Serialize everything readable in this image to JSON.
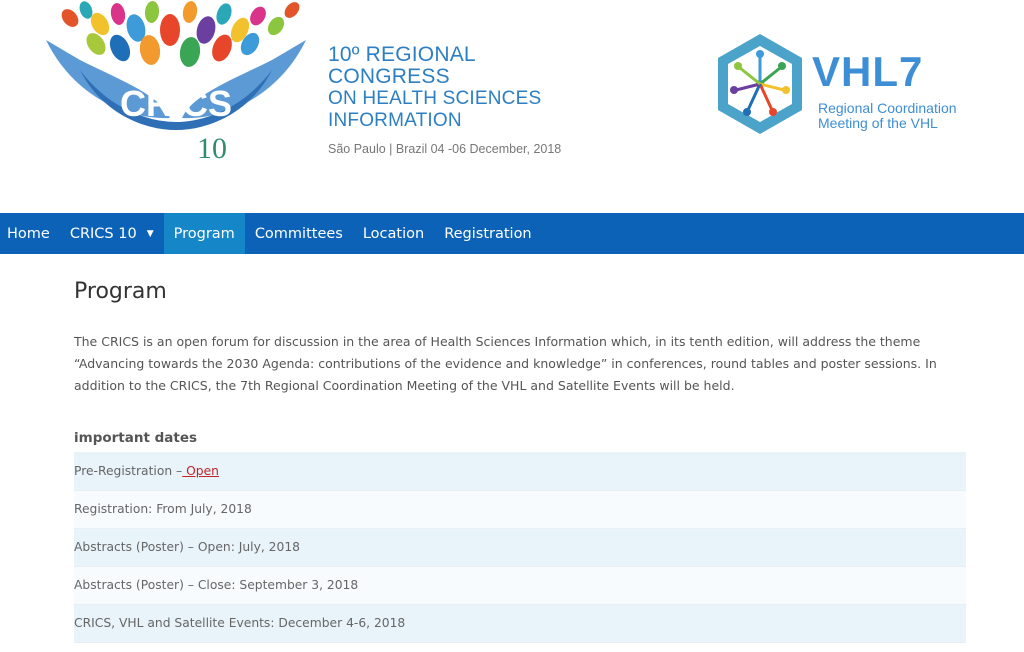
{
  "header": {
    "crics_logo_text": "CRICS",
    "crics_logo_number": "10",
    "congress_line1": "10º REGIONAL CONGRESS",
    "congress_line2": "ON HEALTH SCIENCES",
    "congress_line3": "INFORMATION",
    "congress_place": "São Paulo | Brazil 04 -06 December,  2018",
    "vhl_title": "VHL7",
    "vhl_sub_line1": "Regional Coordination",
    "vhl_sub_line2": "Meeting of the VHL"
  },
  "nav": {
    "items": [
      {
        "label": "Home"
      },
      {
        "label": "CRICS 10",
        "caret": "▼"
      },
      {
        "label": "Program"
      },
      {
        "label": "Committees"
      },
      {
        "label": "Location"
      },
      {
        "label": "Registration"
      }
    ],
    "active": "Program"
  },
  "main": {
    "title": "Program",
    "intro": "The CRICS is an open forum for discussion in the area of Health Sciences Information which, in its tenth edition, will address the theme “Advancing towards the 2030 Agenda: contributions of the evidence and knowledge” in conferences, round tables and poster sessions. In addition to the CRICS, the 7th Regional Coordination Meeting of the VHL and Satellite Events will be held.",
    "dates_title": "important dates",
    "dates": [
      {
        "text": "Pre-Registration –",
        "link": " Open"
      },
      {
        "text": "Registration: From July, 2018"
      },
      {
        "text": "Abstracts (Poster) – Open: July, 2018"
      },
      {
        "text": "Abstracts (Poster) – Close: September 3, 2018"
      },
      {
        "text": "CRICS, VHL and Satellite Events: December 4-6, 2018"
      }
    ]
  },
  "colors": {
    "nav_bg": "#0b62b6",
    "nav_active": "#1586c7",
    "brand_blue": "#2c7fc3",
    "link_red": "#c0242a"
  }
}
